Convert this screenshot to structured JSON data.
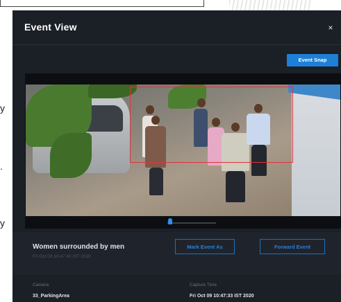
{
  "background": {
    "side_letters": [
      "y",
      ".",
      "y"
    ]
  },
  "modal": {
    "title": "Event View",
    "close_glyph": "×",
    "event_snap_label": "Event Snap",
    "video": {
      "progress": 0.06
    },
    "event": {
      "name": "Women surrounded by men",
      "time": "Fri Oct 09 10:47:40 IST 2020",
      "mark_event_label": "Mark Event As",
      "forward_event_label": "Forward Event"
    },
    "details": {
      "camera_label": "Camera",
      "camera_value": "33_ParkingArea",
      "capture_time_label": "Capture Time",
      "capture_time_value": "Fri Oct 09 10:47:33 IST 2020"
    }
  },
  "colors": {
    "modal_bg": "#1b1f26",
    "accent": "#1e7fd6",
    "bbox": "#e0323a"
  }
}
